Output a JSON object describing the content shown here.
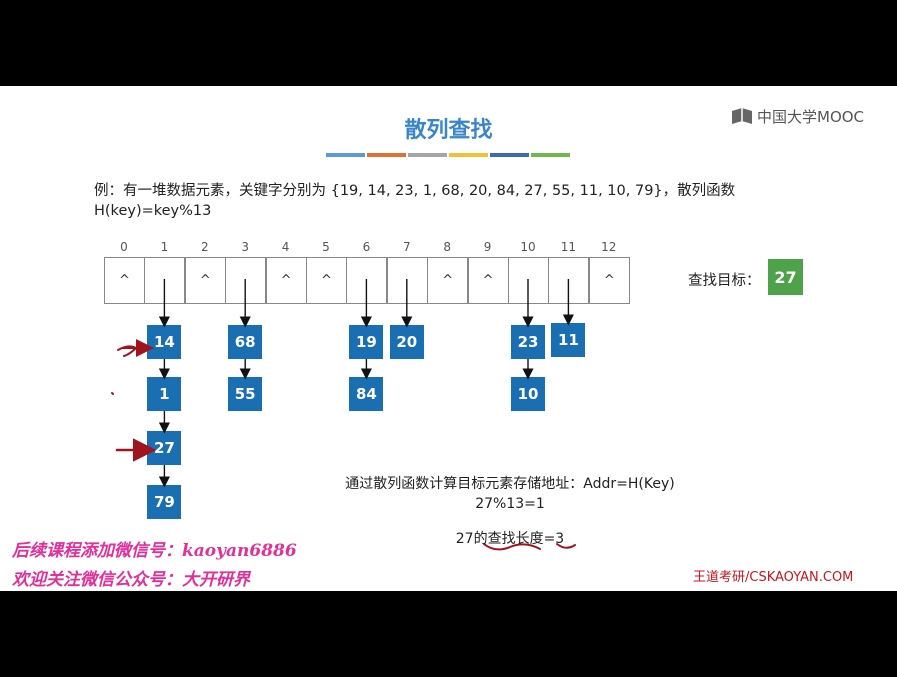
{
  "title": "散列查找",
  "title_bar_colors": [
    "#5b9bd5",
    "#e0703a",
    "#a5a5a5",
    "#f2c037",
    "#3d6bb3",
    "#6fb84a"
  ],
  "logo": {
    "icon": "mooc-logo-icon",
    "text": "中国大学MOOC"
  },
  "problem": {
    "line1": "例：有一堆数据元素，关键字分别为 {19, 14, 23, 1, 68, 20, 84, 27, 55, 11, 10, 79}，散列函数",
    "line2": "H(key)=key%13"
  },
  "table": {
    "indices": [
      "0",
      "1",
      "2",
      "3",
      "4",
      "5",
      "6",
      "7",
      "8",
      "9",
      "10",
      "11",
      "12"
    ],
    "empty_symbol": "^",
    "chains": {
      "1": [
        "14",
        "1",
        "27",
        "79"
      ],
      "3": [
        "68",
        "55"
      ],
      "6": [
        "19",
        "84"
      ],
      "7": [
        "20"
      ],
      "10": [
        "23",
        "10"
      ],
      "11": [
        "11"
      ]
    }
  },
  "target": {
    "label": "查找目标：",
    "value": "27",
    "color": "#4ea24a"
  },
  "explanation": {
    "line1": "通过散列函数计算目标元素存储地址：Addr=H(Key)",
    "line2": "27%13=1",
    "line3": "27的查找长度=3"
  },
  "watermark": {
    "line1": "后续课程添加微信号：kaoyan6886",
    "line2": "欢迎关注微信公众号：大开研界"
  },
  "brand": "王道考研/CSKAOYAN.COM",
  "colors": {
    "node": "#1a6fb2",
    "title": "#3a86c8",
    "pen": "#a0141e"
  }
}
